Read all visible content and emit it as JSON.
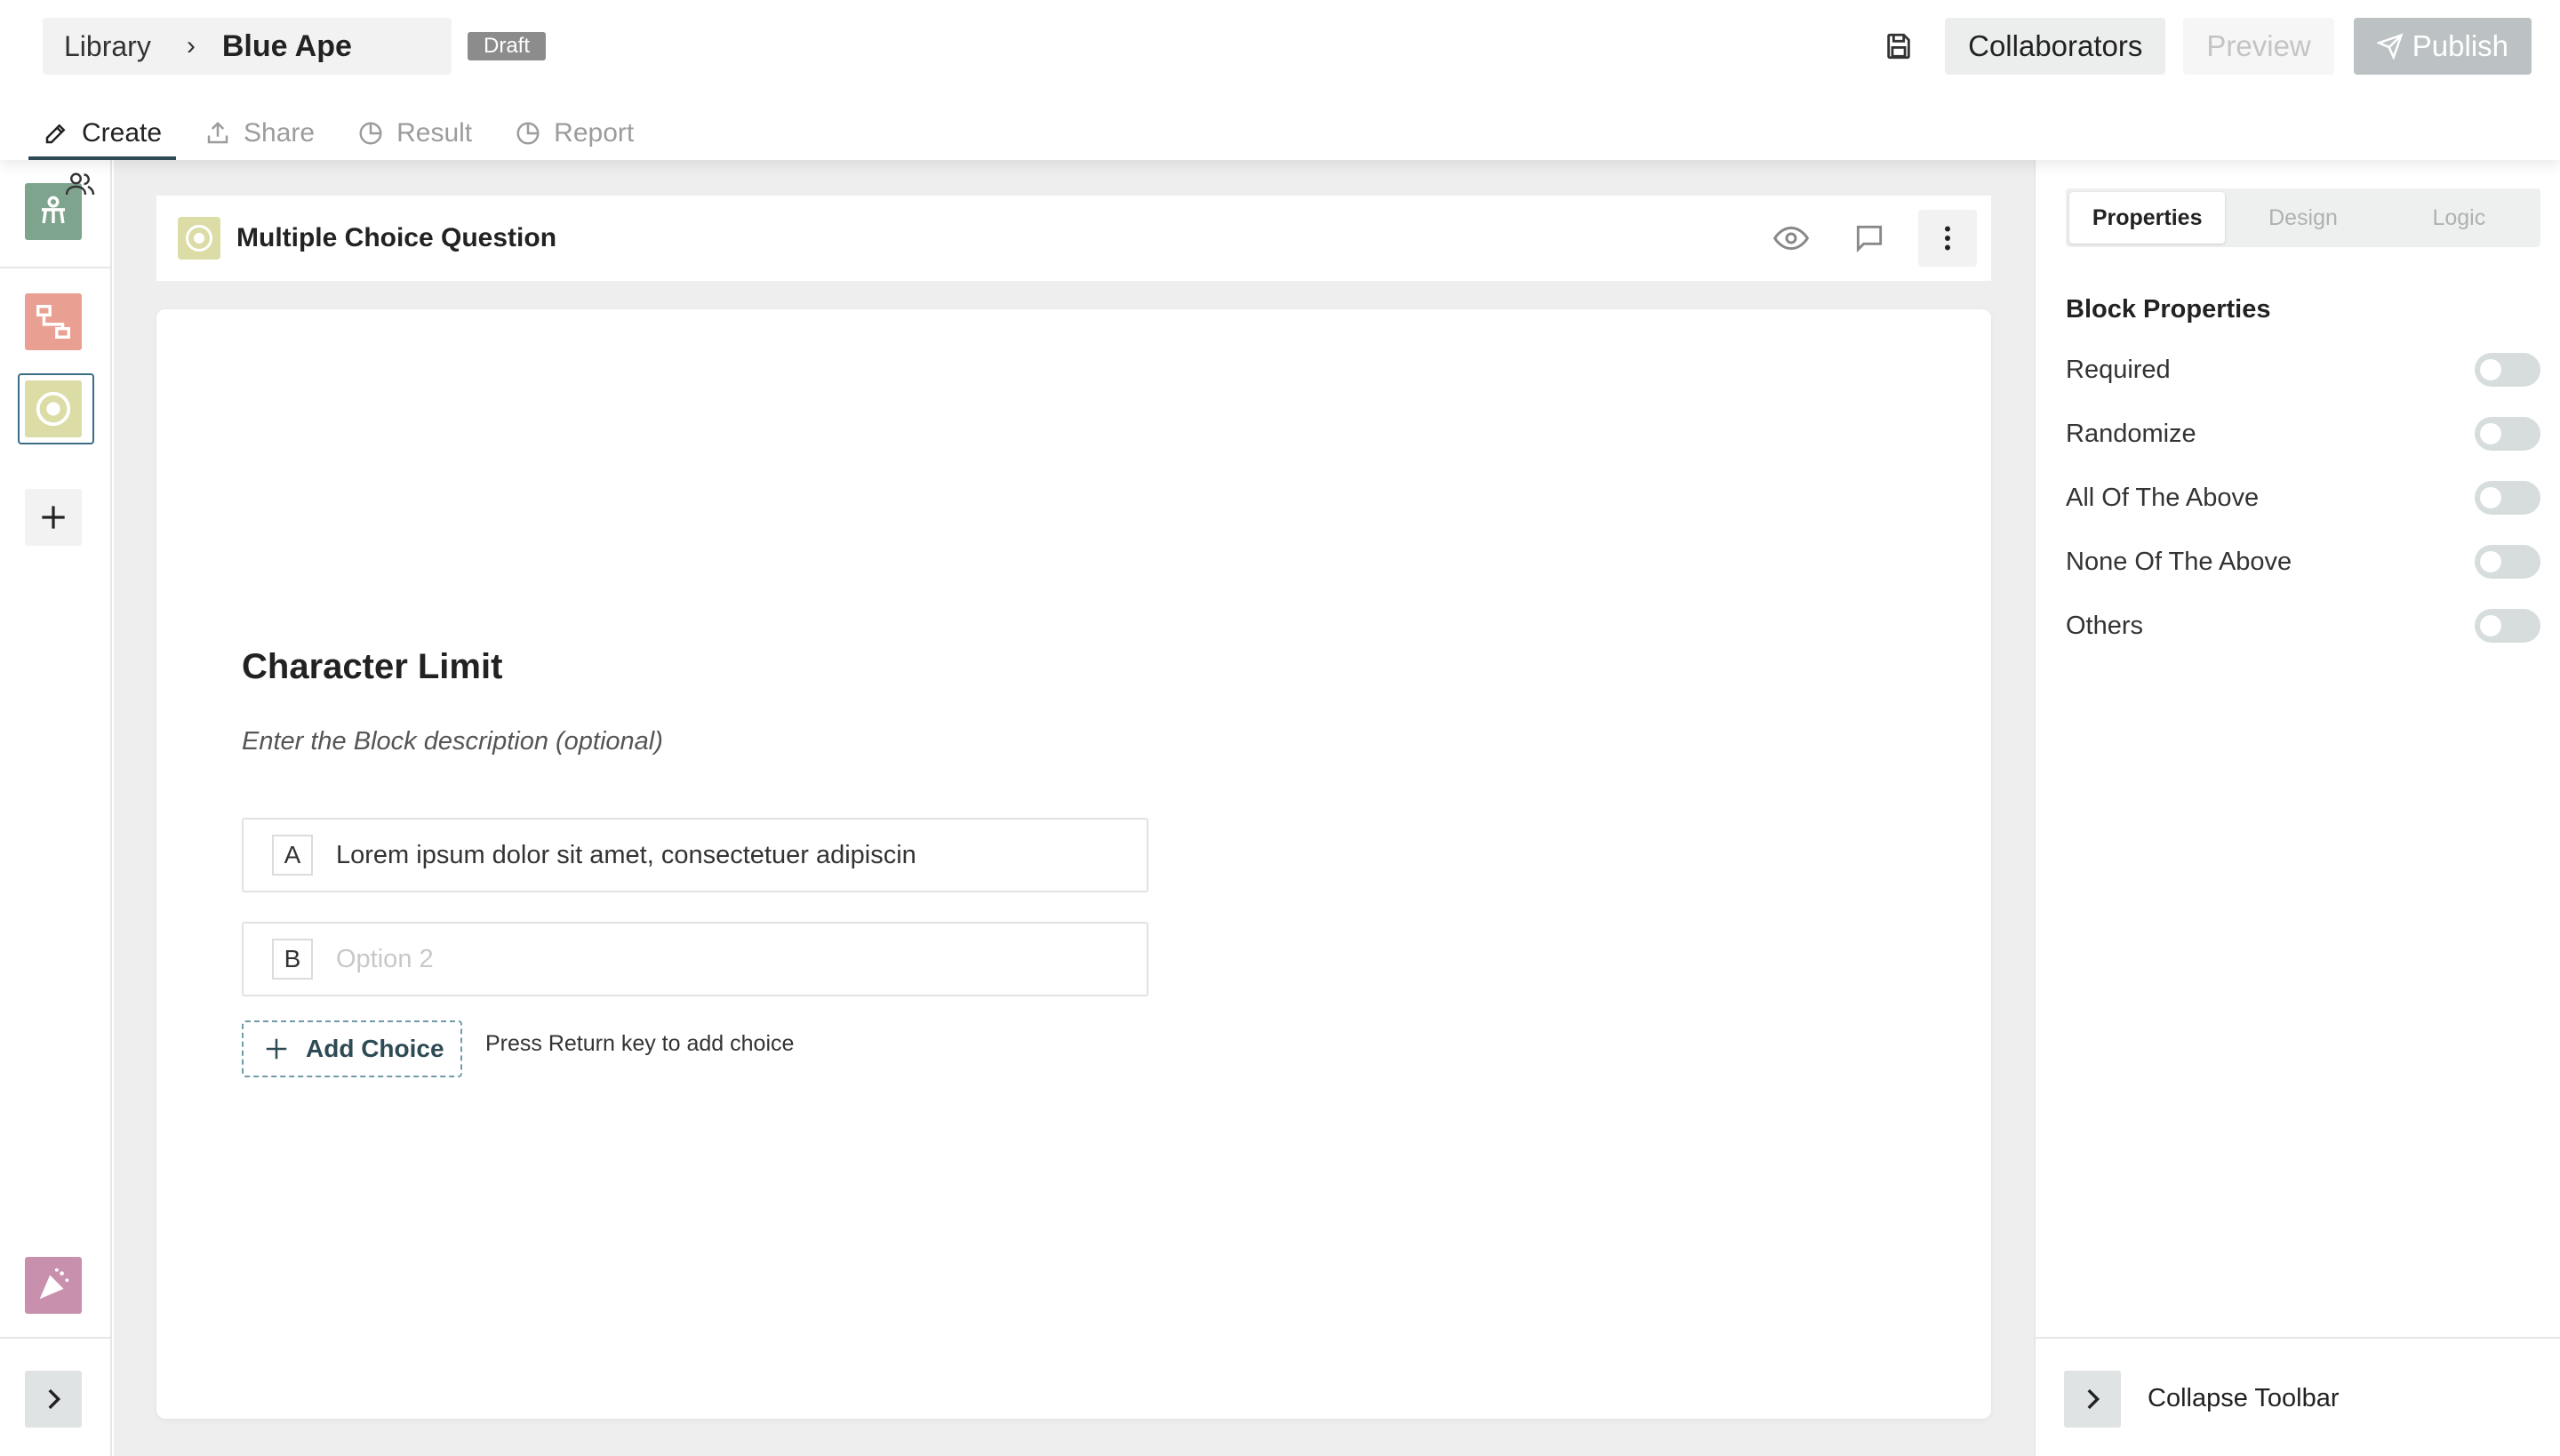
{
  "header": {
    "breadcrumb_root": "Library",
    "breadcrumb_separator": "›",
    "form_name": "Blue Ape",
    "status_badge": "Draft",
    "collaborators_label": "Collaborators",
    "preview_label": "Preview",
    "publish_label": "Publish"
  },
  "tabs": [
    {
      "label": "Create",
      "icon": "pencil-icon",
      "active": true
    },
    {
      "label": "Share",
      "icon": "share-icon",
      "active": false
    },
    {
      "label": "Result",
      "icon": "pie-chart-icon",
      "active": false
    },
    {
      "label": "Report",
      "icon": "pie-chart-icon",
      "active": false
    }
  ],
  "left_rail": {
    "items": [
      {
        "icon": "welcome-screen-icon",
        "color": "#7fa48e"
      },
      {
        "icon": "flow-icon",
        "color": "#e9a092"
      },
      {
        "icon": "radio-choice-icon",
        "color": "#dcdca6",
        "selected": true
      },
      {
        "icon": "plus-icon"
      },
      {
        "icon": "thank-you-icon",
        "color": "#c890ad"
      }
    ]
  },
  "block": {
    "type_label": "Multiple Choice Question",
    "badge_color": "#dcdca6",
    "title": "Character Limit",
    "description_placeholder": "Enter the Block description (optional)",
    "choices": [
      {
        "key": "A",
        "text": "Lorem ipsum dolor sit amet, consectetuer adipiscin",
        "placeholder": false
      },
      {
        "key": "B",
        "text": "Option 2",
        "placeholder": true
      }
    ],
    "add_choice_label": "Add Choice",
    "add_choice_hint": "Press Return key to add choice"
  },
  "panel": {
    "tabs": [
      "Properties",
      "Design",
      "Logic"
    ],
    "active_tab": "Properties",
    "section_title": "Block Properties",
    "properties": [
      {
        "label": "Required",
        "enabled": false
      },
      {
        "label": "Randomize",
        "enabled": false
      },
      {
        "label": "All Of The Above",
        "enabled": false
      },
      {
        "label": "None Of The Above",
        "enabled": false
      },
      {
        "label": "Others",
        "enabled": false
      }
    ],
    "collapse_label": "Collapse Toolbar"
  },
  "colors": {
    "accent": "#2d4a55",
    "selected_outline": "#3c6d86",
    "canvas_bg": "#eeeeee"
  }
}
